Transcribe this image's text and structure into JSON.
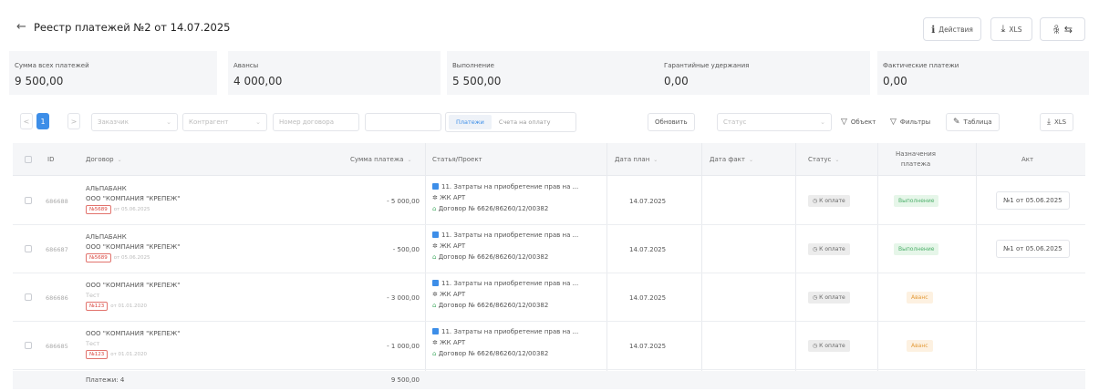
{
  "header": {
    "back_icon": "←",
    "title": "Реестр платежей №2 от 14.07.2025",
    "actions_label": "Действия",
    "xls_label": "XLS",
    "actions_icon": "ℹ",
    "xls_icon": "⤓",
    "users_icon": "⇆"
  },
  "stats": [
    {
      "label": "Сумма всех платежей",
      "value": "9 500,00"
    },
    {
      "label": "Авансы",
      "value": "4 000,00"
    },
    {
      "label": "Выполнение",
      "value": "5 500,00"
    },
    {
      "label": "Гарантийные удержания",
      "value": "0,00"
    },
    {
      "label": "Фактические платежи",
      "value": "0,00"
    }
  ],
  "filters": {
    "page": "1",
    "prev": "<",
    "next": ">",
    "customer_placeholder": "Заказчик",
    "contractor_placeholder": "Контрагент",
    "contract_placeholder": "Номер договора",
    "seg_payments": "Платежи",
    "seg_invoices": "Счета на оплату",
    "refresh_label": "Обновить",
    "status_placeholder": "Статус",
    "object_label": "Объект",
    "filters_label": "Фильтры",
    "table_label": "Таблица",
    "xls_label": "XLS",
    "chevron": "⌄",
    "filter_icon": "▽",
    "edit_icon": "✎",
    "download_icon": "⤓"
  },
  "table": {
    "columns": {
      "id": "ID",
      "contract": "Договор",
      "amount": "Сумма платежа",
      "article": "Статья/Проект",
      "date_plan": "Дата план",
      "date_fact": "Дата факт",
      "status": "Статус",
      "purpose": "Назначения платежа",
      "act": "Акт"
    },
    "sort_icon": "⌄",
    "rows": [
      {
        "id": "686688",
        "name1": "АЛЬПАБАНК",
        "name2": "ООО \"КОМПАНИЯ \"КРЕПЕЖ\"",
        "tag": "№5689",
        "tag_date": "от 05.06.2025",
        "amount": "- 5 000,00",
        "article": "11. Затраты на приобретение прав на ...",
        "project": "ЖК АРТ",
        "contract": "Договор № 6626/86260/12/00382",
        "date_plan": "14.07.2025",
        "date_fact": "",
        "status": "К оплате",
        "purpose": "Выполнение",
        "purpose_kind": "vyp",
        "act": "№1 от 05.06.2025"
      },
      {
        "id": "686687",
        "name1": "АЛЬПАБАНК",
        "name2": "ООО \"КОМПАНИЯ \"КРЕПЕЖ\"",
        "tag": "№5689",
        "tag_date": "от 05.06.2025",
        "amount": "- 500,00",
        "article": "11. Затраты на приобретение прав на ...",
        "project": "ЖК АРТ",
        "contract": "Договор № 6626/86260/12/00382",
        "date_plan": "14.07.2025",
        "date_fact": "",
        "status": "К оплате",
        "purpose": "Выполнение",
        "purpose_kind": "vyp",
        "act": "№1 от 05.06.2025"
      },
      {
        "id": "686686",
        "name1": "ООО \"КОМПАНИЯ \"КРЕПЕЖ\"",
        "name2": "Тест",
        "tag": "№123",
        "tag_date": "от 01.01.2020",
        "amount": "- 3 000,00",
        "article": "11. Затраты на приобретение прав на ...",
        "project": "ЖК АРТ",
        "contract": "Договор № 6626/86260/12/00382",
        "date_plan": "14.07.2025",
        "date_fact": "",
        "status": "К оплате",
        "purpose": "Аванс",
        "purpose_kind": "av",
        "act": ""
      },
      {
        "id": "686685",
        "name1": "ООО \"КОМПАНИЯ \"КРЕПЕЖ\"",
        "name2": "Тест",
        "tag": "№123",
        "tag_date": "от 01.01.2020",
        "amount": "- 1 000,00",
        "article": "11. Затраты на приобретение прав на ...",
        "project": "ЖК АРТ",
        "contract": "Договор № 6626/86260/12/00382",
        "date_plan": "14.07.2025",
        "date_fact": "",
        "status": "К оплате",
        "purpose": "Аванс",
        "purpose_kind": "av",
        "act": ""
      }
    ],
    "footer": {
      "count_label": "Платежи: 4",
      "total": "9 500,00"
    }
  },
  "icons": {
    "status_icon": "◷",
    "project_icon": "✲",
    "contract_icon": "⌂"
  }
}
